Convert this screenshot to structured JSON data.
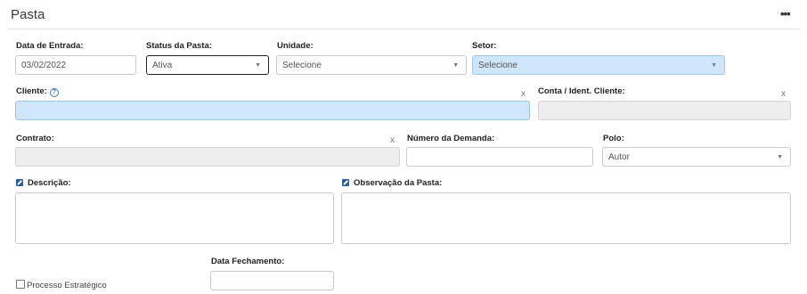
{
  "panel": {
    "title": "Pasta",
    "more_icon": "•••"
  },
  "fields": {
    "data_entrada": {
      "label": "Data de Entrada:",
      "value": "03/02/2022"
    },
    "status_pasta": {
      "label": "Status da Pasta:",
      "value": "Ativa"
    },
    "unidade": {
      "label": "Unidade:",
      "value": "Selecione"
    },
    "setor": {
      "label": "Setor:",
      "value": "Selecione"
    },
    "cliente": {
      "label": "Cliente:",
      "value": "",
      "clear": "x",
      "help_icon": "?"
    },
    "conta_ident": {
      "label": "Conta / Ident. Cliente:",
      "value": "",
      "clear": "x"
    },
    "contrato": {
      "label": "Contrato:",
      "value": "",
      "clear": "x"
    },
    "numero_demanda": {
      "label": "Número da Demanda:",
      "value": ""
    },
    "polo": {
      "label": "Polo:",
      "value": "Autor"
    },
    "descricao": {
      "label": "Descrição:",
      "value": ""
    },
    "observacao": {
      "label": "Observação da Pasta:",
      "value": ""
    },
    "data_fechamento": {
      "label": "Data Fechamento:",
      "value": ""
    },
    "processo_estrategico": {
      "label": "Processo Estratégico",
      "checked": false
    }
  },
  "icons": {
    "caret": "▼",
    "edit": "edit-icon",
    "help": "help-icon"
  },
  "colors": {
    "highlight": "#cfe6fd",
    "disabled": "#eeeeee",
    "edit_icon": "#2a5e9c"
  }
}
